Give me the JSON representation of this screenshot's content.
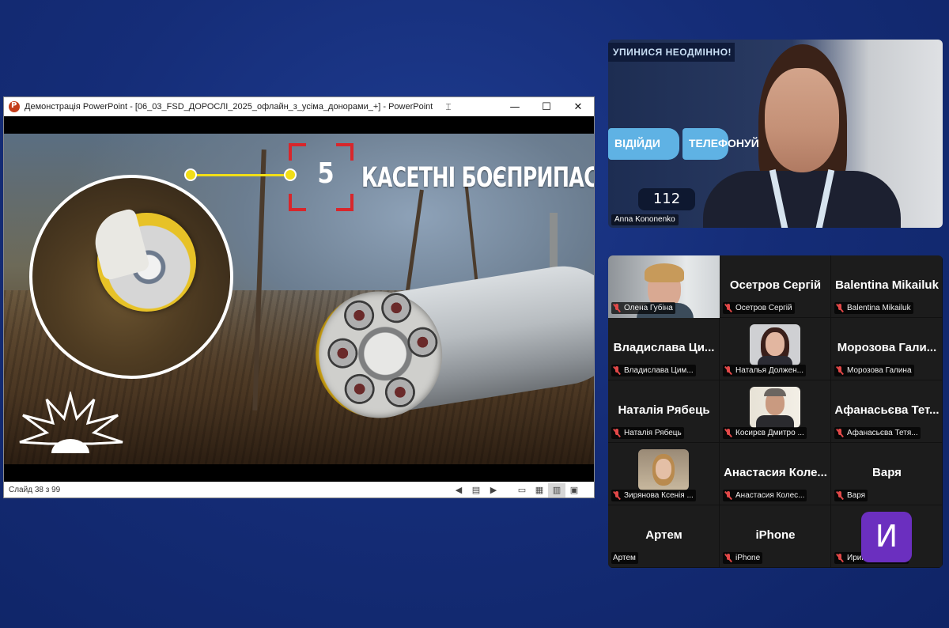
{
  "ppt": {
    "title": "Демонстрація PowerPoint - [06_03_FSD_ДОРОСЛІ_2025_офлайн_з_усіма_донорами_+] - PowerPoint",
    "controls": {
      "minimize": "—",
      "maximize": "☐",
      "close": "✕"
    },
    "status": "Слайд 38 з 99"
  },
  "slide": {
    "number": "5",
    "heading": "КАСЕТНІ БОЄПРИПАСИ",
    "colors": {
      "accent_yellow": "#f1de17",
      "bracket_red": "#d8262b"
    }
  },
  "presenter": {
    "name": "Anna Kononenko",
    "banner_top": "УПИНИСЯ НЕОДМІННО!",
    "pill_left": "ВІДІЙДИ",
    "pill_right": "ТЕЛЕФОНУЙ",
    "phone": "112"
  },
  "gallery": {
    "tiles": [
      {
        "label": "Олена Губіна",
        "display": "",
        "video": true
      },
      {
        "label": "Осетров Сергій",
        "display": "Осетров Сергій",
        "video": false
      },
      {
        "label": "Balentina Mikailuk",
        "display": "Balentina Mikailuk",
        "video": false
      },
      {
        "label": "Владислава Цим...",
        "display": "Владислава Ци...",
        "video": false
      },
      {
        "label": "Наталья Должен...",
        "display": "",
        "video": true
      },
      {
        "label": "Морозова Галина",
        "display": "Морозова Гали...",
        "video": false
      },
      {
        "label": "Наталія Рябець",
        "display": "Наталія Рябець",
        "video": false
      },
      {
        "label": "Косирєв Дмитро ...",
        "display": "",
        "video": true
      },
      {
        "label": "Афанасьєва Тетя...",
        "display": "Афанасьєва Тет...",
        "video": false
      },
      {
        "label": "Зирянова Ксенія ...",
        "display": "",
        "video": true
      },
      {
        "label": "Анастасия Колес...",
        "display": "Анастасия Коле...",
        "video": false
      },
      {
        "label": "Варя",
        "display": "Варя",
        "video": false
      },
      {
        "label": "Артем",
        "display": "Артем",
        "video": false,
        "muted": false
      },
      {
        "label": "iPhone",
        "display": "iPhone",
        "video": false
      },
      {
        "label": "Ирина Сигитова",
        "display": "",
        "video": false,
        "avatar_letter": "И"
      }
    ]
  }
}
